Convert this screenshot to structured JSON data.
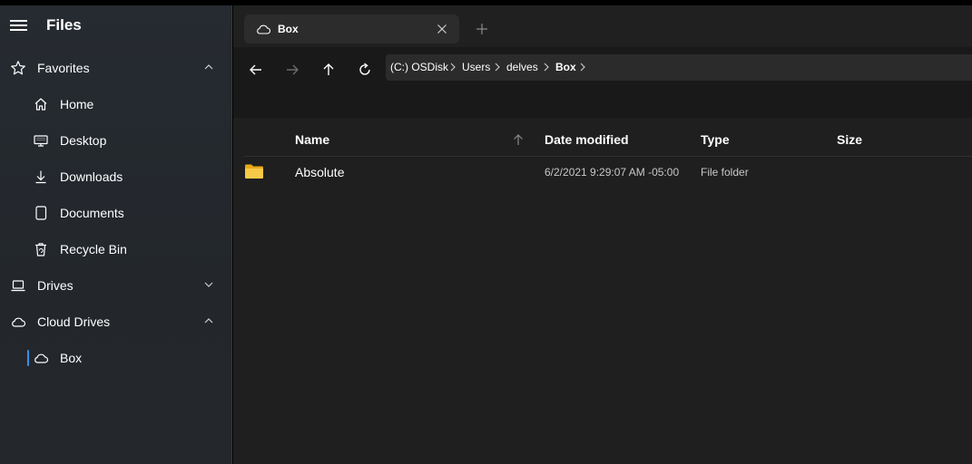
{
  "app": {
    "title": "Files"
  },
  "sidebar": {
    "sections": [
      {
        "label": "Favorites",
        "icon": "star-icon",
        "expanded": true
      },
      {
        "label": "Drives",
        "icon": "laptop-icon",
        "expanded": false
      },
      {
        "label": "Cloud Drives",
        "icon": "cloud-icon",
        "expanded": true
      }
    ],
    "favorites": [
      {
        "label": "Home",
        "icon": "home-icon"
      },
      {
        "label": "Desktop",
        "icon": "desktop-icon"
      },
      {
        "label": "Downloads",
        "icon": "download-icon"
      },
      {
        "label": "Documents",
        "icon": "document-icon"
      },
      {
        "label": "Recycle Bin",
        "icon": "recycle-bin-icon"
      }
    ],
    "cloud_drives": [
      {
        "label": "Box",
        "icon": "cloud-icon",
        "selected": true
      }
    ]
  },
  "tabs": [
    {
      "label": "Box",
      "icon": "cloud-icon",
      "active": true
    }
  ],
  "breadcrumb": [
    "(C:) OSDisk",
    "Users",
    "delves",
    "Box"
  ],
  "columns": {
    "name": "Name",
    "date_modified": "Date modified",
    "type": "Type",
    "size": "Size"
  },
  "files": [
    {
      "name": "Absolute",
      "date_modified": "6/2/2021 9:29:07 AM -05:00",
      "type": "File folder",
      "size": "",
      "icon": "folder-icon"
    }
  ],
  "colors": {
    "accent": "#3b8eea",
    "folder": "#f7c948",
    "sidebar_bg": "#24282d",
    "content_bg": "#1f1f1f"
  }
}
